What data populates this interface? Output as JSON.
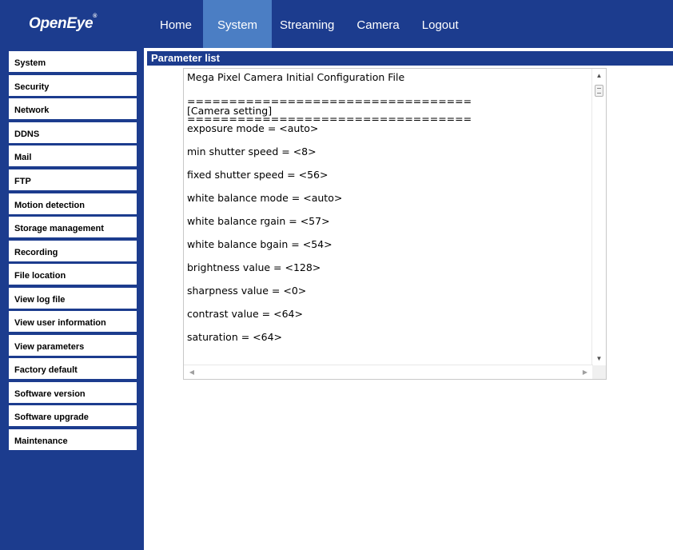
{
  "brand": {
    "logo": "OpenEye",
    "mark": "®"
  },
  "nav": {
    "items": [
      {
        "label": "Home"
      },
      {
        "label": "System",
        "active": true
      },
      {
        "label": "Streaming"
      },
      {
        "label": "Camera"
      },
      {
        "label": "Logout"
      }
    ]
  },
  "sidebar": {
    "items": [
      {
        "label": "System"
      },
      {
        "label": "Security"
      },
      {
        "label": "Network"
      },
      {
        "label": "DDNS"
      },
      {
        "label": "Mail"
      },
      {
        "label": "FTP"
      },
      {
        "label": "Motion detection"
      },
      {
        "label": "Storage management"
      },
      {
        "label": "Recording"
      },
      {
        "label": "File location"
      },
      {
        "label": "View log file"
      },
      {
        "label": "View user information"
      },
      {
        "label": "View parameters"
      },
      {
        "label": "Factory default"
      },
      {
        "label": "Software version"
      },
      {
        "label": "Software upgrade"
      },
      {
        "label": "Maintenance"
      }
    ]
  },
  "main": {
    "section_title": "Parameter list",
    "parameters": {
      "lines": [
        "Mega Pixel Camera Initial Configuration File",
        "",
        "==================================",
        "[Camera setting]",
        "==================================",
        "exposure mode = <auto>",
        "",
        "min shutter speed = <8>",
        "",
        "fixed shutter speed = <56>",
        "",
        "white balance mode = <auto>",
        "",
        "white balance rgain = <57>",
        "",
        "white balance bgain = <54>",
        "",
        "brightness value = <128>",
        "",
        "sharpness value = <0>",
        "",
        "contrast value = <64>",
        "",
        "saturation = <64>"
      ]
    }
  },
  "icons": {
    "scroll_up": "scroll-up-arrow-icon",
    "scroll_down": "scroll-down-arrow-icon",
    "scroll_left": "scroll-left-arrow-icon",
    "scroll_right": "scroll-right-arrow-icon"
  },
  "colors": {
    "navy": "#1c3c8e",
    "active_tab": "#4b7ec4",
    "white": "#ffffff"
  }
}
